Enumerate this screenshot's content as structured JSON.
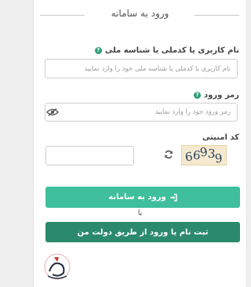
{
  "header": {
    "title": "ورود به سامانه"
  },
  "username": {
    "label": "نام کاربری یا کدملی یا شناسه ملی",
    "placeholder": "نام کاربری یا کدملی یا شناسه ملی خود را وارد نمایید"
  },
  "password": {
    "label": "رمز ورود",
    "placeholder": "رمز ورود خود را وارد نمایید"
  },
  "captcha": {
    "label": "کد امنیتی",
    "digits": [
      "6",
      "6",
      "9",
      "3",
      "9"
    ],
    "value": ""
  },
  "actions": {
    "login_label": "ورود به سامانه",
    "or_text": "یا",
    "gov_label": "ثبت نام یا ورود از طریق دولت من"
  },
  "colors": {
    "primary": "#3fbf9b",
    "secondary": "#2b8a6b",
    "help": "#2f9e77"
  },
  "icons": [
    "help-icon",
    "eye-slash-icon",
    "refresh-icon",
    "sign-in-icon"
  ]
}
